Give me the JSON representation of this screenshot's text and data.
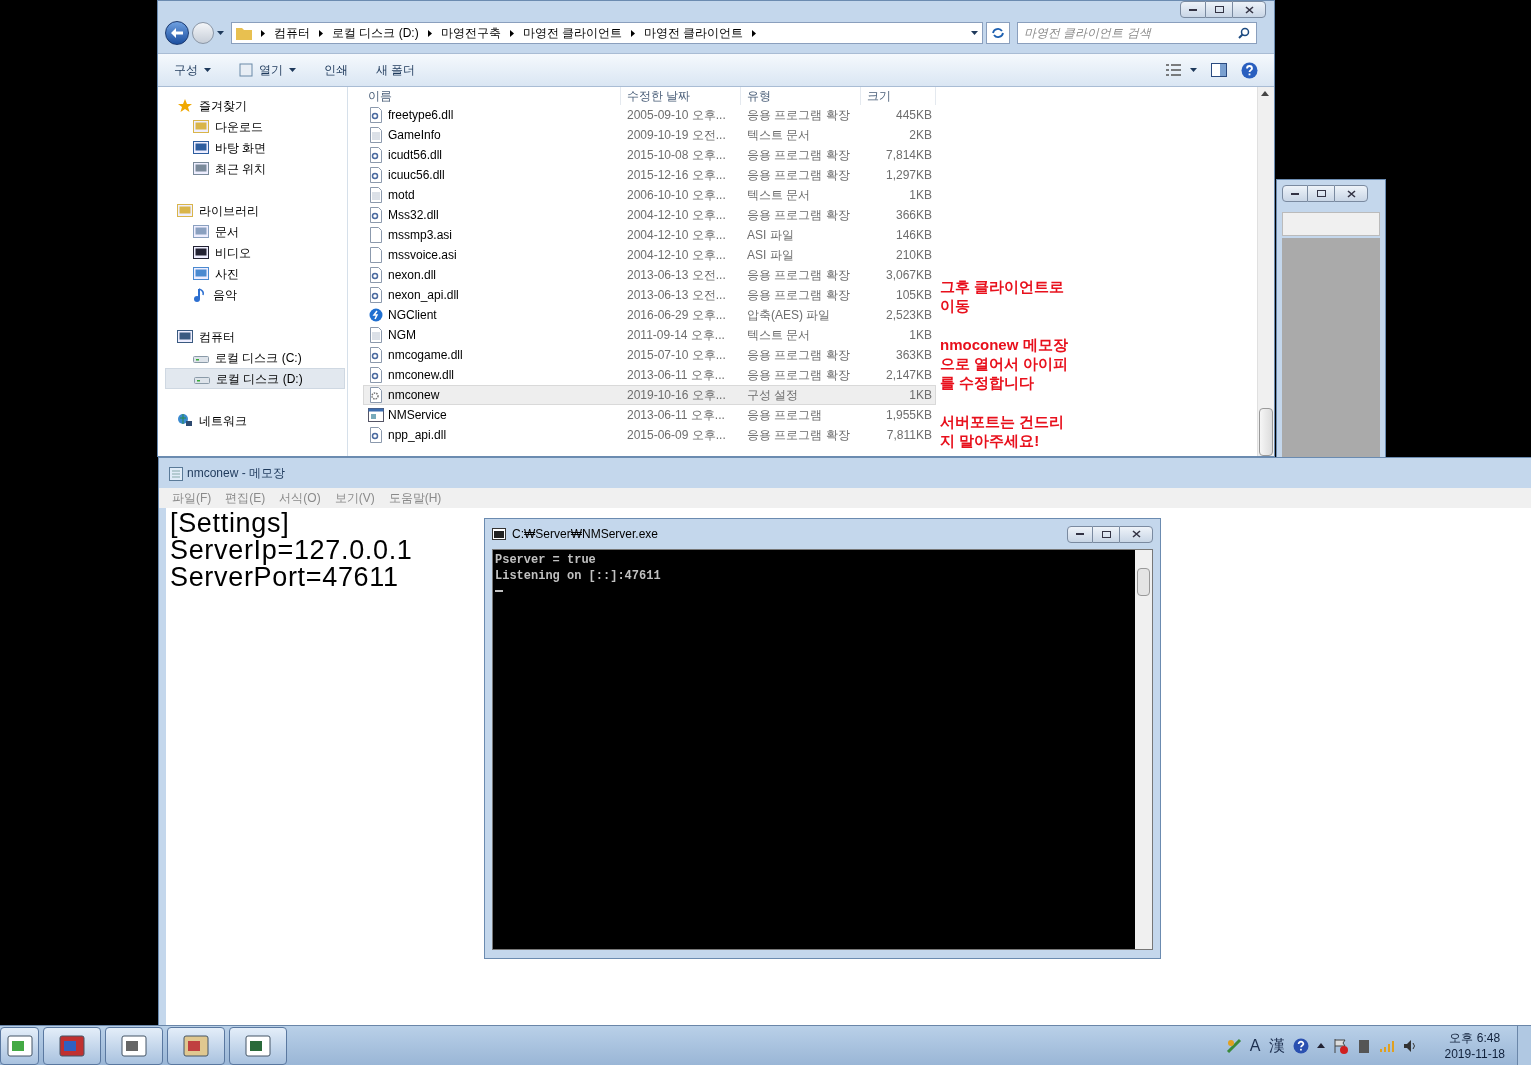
{
  "explorer": {
    "breadcrumb": [
      "컴퓨터",
      "로컬 디스크 (D:)",
      "마영전구축",
      "마영전 클라이언트",
      "마영전 클라이언트"
    ],
    "search": {
      "placeholder": "마영전 클라이언트 검색"
    },
    "toolbar": [
      {
        "label": "구성",
        "kind": "menu"
      },
      {
        "label": "열기",
        "kind": "open"
      },
      {
        "label": "인쇄",
        "kind": "plain"
      },
      {
        "label": "새 폴더",
        "kind": "plain"
      }
    ],
    "nav": [
      {
        "label": "즐겨찾기",
        "kind": "star",
        "selected": false,
        "children": [
          {
            "label": "다운로드",
            "kind": "download",
            "selected": false
          },
          {
            "label": "바탕 화면",
            "kind": "desktop",
            "selected": false
          },
          {
            "label": "최근 위치",
            "kind": "recent",
            "selected": false
          }
        ]
      },
      {
        "label": "라이브러리",
        "kind": "library",
        "selected": false,
        "children": [
          {
            "label": "문서",
            "kind": "doc",
            "selected": false
          },
          {
            "label": "비디오",
            "kind": "video",
            "selected": false
          },
          {
            "label": "사진",
            "kind": "picture",
            "selected": false
          },
          {
            "label": "음악",
            "kind": "music",
            "selected": false
          }
        ]
      },
      {
        "label": "컴퓨터",
        "kind": "computer",
        "selected": false,
        "children": [
          {
            "label": "로컬 디스크 (C:)",
            "kind": "drive",
            "selected": false
          },
          {
            "label": "로컬 디스크 (D:)",
            "kind": "drive",
            "selected": true
          }
        ]
      },
      {
        "label": "네트워크",
        "kind": "network",
        "selected": false
      }
    ],
    "columns": [
      "이름",
      "수정한 날짜",
      "유형",
      "크기"
    ],
    "rows": [
      {
        "name": "freetype6.dll",
        "date": "2005-09-10 오후...",
        "type": "응용 프로그램 확장",
        "size": "445KB",
        "kind": "dll",
        "selected": false
      },
      {
        "name": "GameInfo",
        "date": "2009-10-19 오전...",
        "type": "텍스트 문서",
        "size": "2KB",
        "kind": "text",
        "selected": false
      },
      {
        "name": "icudt56.dll",
        "date": "2015-10-08 오후...",
        "type": "응용 프로그램 확장",
        "size": "7,814KB",
        "kind": "dll",
        "selected": false
      },
      {
        "name": "icuuc56.dll",
        "date": "2015-12-16 오후...",
        "type": "응용 프로그램 확장",
        "size": "1,297KB",
        "kind": "dll",
        "selected": false
      },
      {
        "name": "motd",
        "date": "2006-10-10 오후...",
        "type": "텍스트 문서",
        "size": "1KB",
        "kind": "text",
        "selected": false
      },
      {
        "name": "Mss32.dll",
        "date": "2004-12-10 오후...",
        "type": "응용 프로그램 확장",
        "size": "366KB",
        "kind": "dll",
        "selected": false
      },
      {
        "name": "mssmp3.asi",
        "date": "2004-12-10 오후...",
        "type": "ASI 파일",
        "size": "146KB",
        "kind": "blank",
        "selected": false
      },
      {
        "name": "mssvoice.asi",
        "date": "2004-12-10 오후...",
        "type": "ASI 파일",
        "size": "210KB",
        "kind": "blank",
        "selected": false
      },
      {
        "name": "nexon.dll",
        "date": "2013-06-13 오전...",
        "type": "응용 프로그램 확장",
        "size": "3,067KB",
        "kind": "dll",
        "selected": false
      },
      {
        "name": "nexon_api.dll",
        "date": "2013-06-13 오전...",
        "type": "응용 프로그램 확장",
        "size": "105KB",
        "kind": "dll",
        "selected": false
      },
      {
        "name": "NGClient",
        "date": "2016-06-29 오후...",
        "type": "압축(AES) 파일",
        "size": "2,523KB",
        "kind": "app",
        "selected": false
      },
      {
        "name": "NGM",
        "date": "2011-09-14 오후...",
        "type": "텍스트 문서",
        "size": "1KB",
        "kind": "text",
        "selected": false
      },
      {
        "name": "nmcogame.dll",
        "date": "2015-07-10 오후...",
        "type": "응용 프로그램 확장",
        "size": "363KB",
        "kind": "dll",
        "selected": false
      },
      {
        "name": "nmconew.dll",
        "date": "2013-06-11 오후...",
        "type": "응용 프로그램 확장",
        "size": "2,147KB",
        "kind": "dll",
        "selected": false
      },
      {
        "name": "nmconew",
        "date": "2019-10-16 오후...",
        "type": "구성 설정",
        "size": "1KB",
        "kind": "config",
        "selected": true
      },
      {
        "name": "NMService",
        "date": "2013-06-11 오후...",
        "type": "응용 프로그램",
        "size": "1,955KB",
        "kind": "exe",
        "selected": false
      },
      {
        "name": "npp_api.dll",
        "date": "2015-06-09 오후...",
        "type": "응용 프로그램 확장",
        "size": "7,811KB",
        "kind": "dll",
        "selected": false
      }
    ],
    "annotations": [
      [
        "그후 클라이언트로",
        "이동"
      ],
      [
        "nmoconew 메모장",
        "으로 열어서 아이피",
        "를 수정합니다"
      ],
      [
        "서버포트는 건드리",
        "지 말아주세요!"
      ]
    ]
  },
  "notepad": {
    "title": "nmconew - 메모장",
    "menu": [
      "파일(F)",
      "편집(E)",
      "서식(O)",
      "보기(V)",
      "도움말(H)"
    ],
    "lines": [
      "[Settings]",
      "ServerIp=127.0.0.1",
      "ServerPort=47611"
    ]
  },
  "console": {
    "title": "C:₩Server₩NMServer.exe",
    "lines": [
      "Pserver = true",
      "Listening on [::]:47611"
    ]
  },
  "tray": {
    "ime": [
      "A",
      "漢"
    ],
    "time": "오후 6:48",
    "date": "2019-11-18"
  }
}
